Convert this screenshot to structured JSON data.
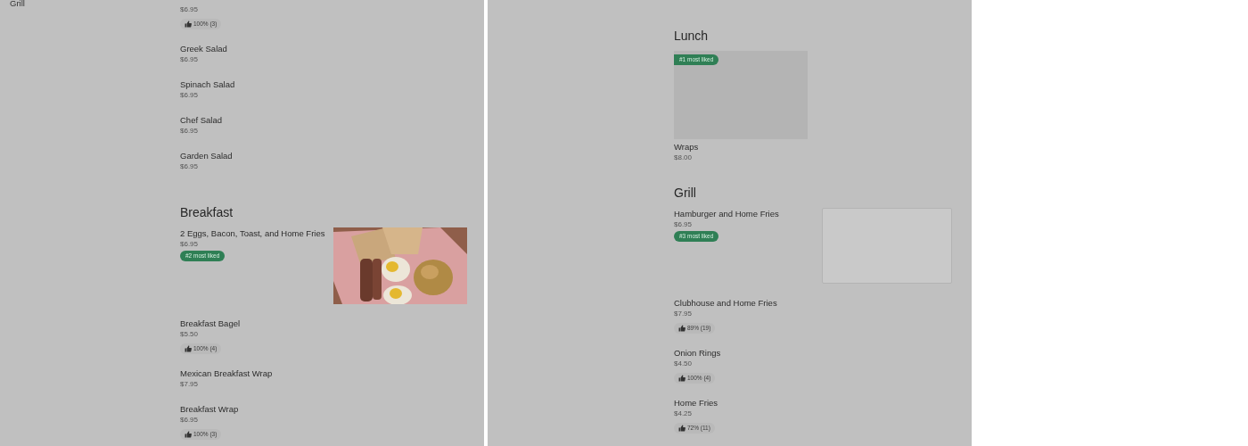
{
  "left_panel": {
    "sidebar": {
      "items": [
        {
          "label": "Grill"
        }
      ]
    },
    "sections": [
      {
        "kind": "list",
        "items": [
          {
            "price": "$6.95",
            "rating": "100% (3)"
          },
          {
            "name": "Greek Salad",
            "price": "$6.95"
          },
          {
            "name": "Spinach Salad",
            "price": "$6.95"
          },
          {
            "name": "Chef Salad",
            "price": "$6.95"
          },
          {
            "name": "Garden Salad",
            "price": "$6.95"
          }
        ]
      },
      {
        "kind": "list",
        "title": "Breakfast",
        "items": [
          {
            "name": "2 Eggs, Bacon, Toast, and Home Fries",
            "price": "$6.95",
            "badge": "#2 most liked"
          },
          {
            "name": "Breakfast Bagel",
            "price": "$5.50",
            "rating": "100% (4)"
          },
          {
            "name": "Mexican Breakfast Wrap",
            "price": "$7.95"
          },
          {
            "name": "Breakfast Wrap",
            "price": "$6.95",
            "rating": "100% (3)"
          }
        ]
      }
    ]
  },
  "right_panel": {
    "sections": [
      {
        "kind": "cards",
        "title": "Lunch",
        "items": [
          {
            "name": "Wraps",
            "price": "$8.00",
            "badge": "#1 most liked",
            "image": {
              "kind": "placeholder"
            }
          }
        ]
      },
      {
        "kind": "list",
        "title": "Grill",
        "items": [
          {
            "name": "Hamburger and Home Fries",
            "price": "$6.95",
            "badge": "#3 most liked",
            "image": {
              "kind": "placeholder"
            }
          },
          {
            "name": "Clubhouse and Home Fries",
            "price": "$7.95",
            "rating": "89% (19)"
          },
          {
            "name": "Onion Rings",
            "price": "$4.50",
            "rating": "100% (4)"
          },
          {
            "name": "Home Fries",
            "price": "$4.25",
            "rating": "72% (11)"
          }
        ]
      }
    ]
  }
}
